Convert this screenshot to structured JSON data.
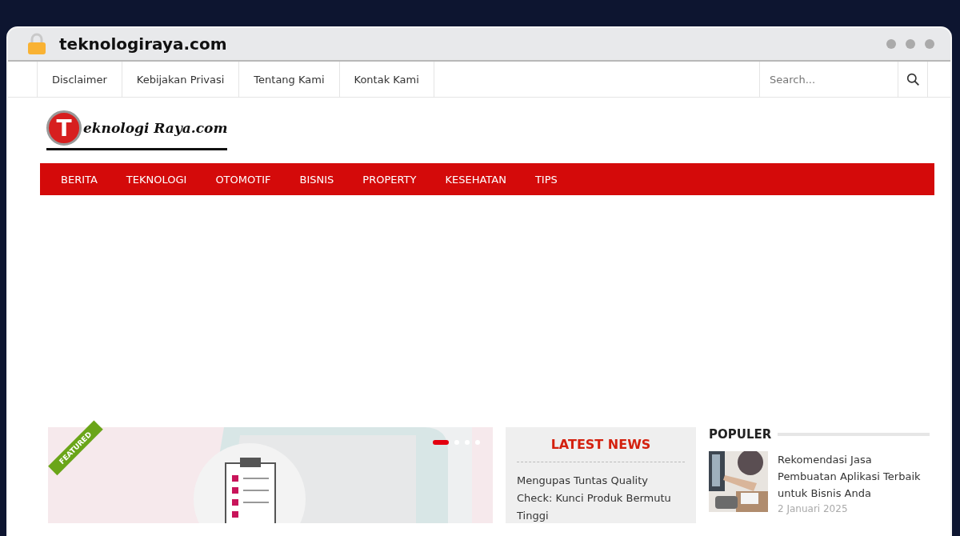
{
  "browser": {
    "url": "teknologiraya.com"
  },
  "top_menu": [
    "Disclaimer",
    "Kebijakan Privasi",
    "Tentang Kami",
    "Kontak Kami"
  ],
  "search": {
    "placeholder": "Search..."
  },
  "logo": {
    "initial": "T",
    "text": "eknologi Raya.com"
  },
  "main_menu": [
    "BERITA",
    "TEKNOLOGI",
    "OTOMOTIF",
    "BISNIS",
    "PROPERTY",
    "KESEHATAN",
    "TIPS"
  ],
  "featured": {
    "ribbon": "FEATURED",
    "slides": [
      {
        "selected": true
      },
      {
        "selected": false
      },
      {
        "selected": false
      },
      {
        "selected": false
      }
    ]
  },
  "latest_news": {
    "title": "LATEST NEWS",
    "items": [
      "Mengupas Tuntas Quality Check: Kunci Produk Bermutu Tinggi"
    ]
  },
  "popular": {
    "title": "POPULER",
    "items": [
      {
        "title": "Rekomendasi Jasa Pembuatan Aplikasi Terbaik untuk Bisnis Anda",
        "date": "2 Januari 2025"
      }
    ]
  }
}
